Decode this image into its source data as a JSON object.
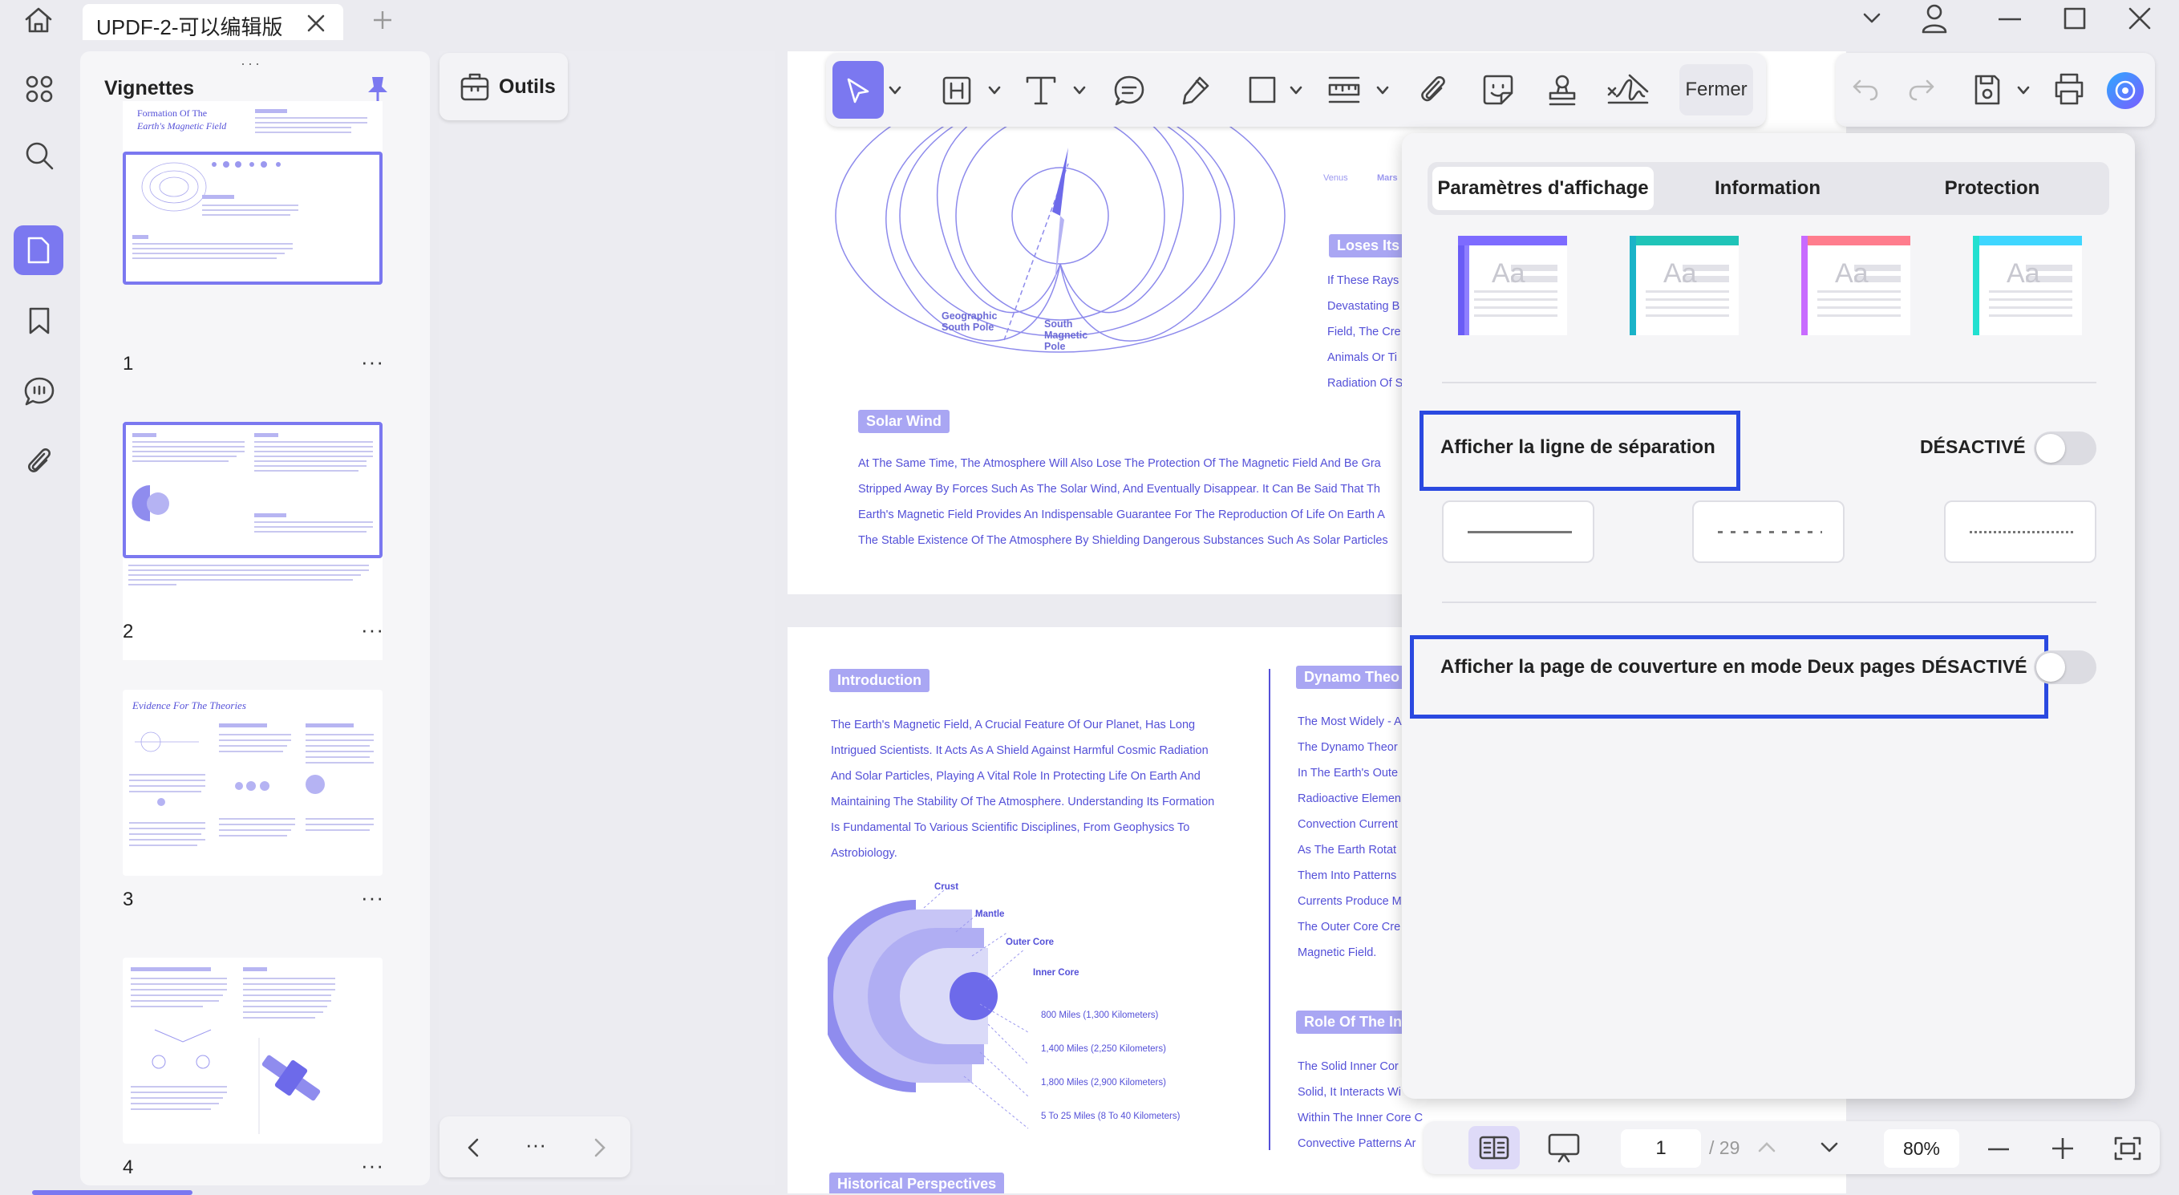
{
  "window": {
    "tab_title": "UPDF-2-可以编辑版"
  },
  "thumbnails": {
    "title": "Vignettes",
    "pages": [
      {
        "num": "1"
      },
      {
        "num": "2"
      },
      {
        "num": "3"
      },
      {
        "num": "4"
      }
    ],
    "more": "···",
    "thumb1_title": "Formation Of The",
    "thumb1_subtitle": "Earth's Magnetic Field",
    "thumb3_title": "Evidence For The Theories"
  },
  "middle": {
    "outils_label": "Outils",
    "nav_more": "···"
  },
  "toolbar": {
    "fermer_label": "Fermer"
  },
  "pdf": {
    "page_a": {
      "geo_label": "Geographic\nSouth Pole",
      "south_label": "South\nMagnetic\nPole",
      "venus": "Venus",
      "mars": "Mars",
      "loses": "Loses Its",
      "right_lines": [
        "If These Rays",
        "Devastating B",
        "Field, The Cre",
        "Animals Or Ti",
        "Radiation Of S"
      ],
      "solar_wind": "Solar Wind",
      "solar_lines": [
        "At The Same Time, The Atmosphere Will Also Lose The Protection Of The Magnetic Field And Be Gra",
        "Stripped Away By Forces Such As The Solar Wind, And Eventually Disappear. It Can Be Said That Th",
        "Earth's Magnetic Field Provides An Indispensable Guarantee For The Reproduction Of Life On Earth A",
        "The Stable Existence Of The Atmosphere By Shielding Dangerous Substances Such As Solar Particles"
      ]
    },
    "page_b": {
      "introduction": "Introduction",
      "intro_lines": [
        "The Earth's Magnetic Field, A Crucial Feature Of Our Planet, Has Long",
        "Intrigued Scientists. It Acts As A Shield Against Harmful Cosmic Radiation",
        "And Solar Particles, Playing A Vital Role In Protecting Life On Earth And",
        "Maintaining The Stability Of The Atmosphere. Understanding Its Formation",
        "Is Fundamental To Various Scientific Disciplines, From Geophysics To",
        "Astrobiology."
      ],
      "crust": "Crust",
      "mantle": "Mantle",
      "outer_core": "Outer Core",
      "inner_core": "Inner Core",
      "depths": [
        "800 Miles (1,300 Kilometers)",
        "1,400 Miles (2,250 Kilometers)",
        "1,800 Miles (2,900 Kilometers)",
        "5 To 25 Miles (8 To 40 Kilometers)"
      ],
      "dynamo": "Dynamo Theo",
      "dynamo_lines": [
        "The Most Widely - A",
        "The Dynamo Theor",
        "In The Earth's Oute",
        "Radioactive Elemen",
        "Convection Current",
        "As The Earth Rotat",
        "Them Into Patterns",
        "Currents Produce M",
        "The Outer Core Cre",
        "Magnetic Field."
      ],
      "role": "Role Of The In",
      "role_lines": [
        "The Solid Inner Cor",
        "Solid, It Interacts Wi",
        "Within The Inner Core C",
        "Convective Patterns Ar"
      ],
      "historical": "Historical Perspectives"
    }
  },
  "popup": {
    "tabs": [
      "Paramètres d'affichage",
      "Information",
      "Protection"
    ],
    "separator_label": "Afficher la ligne de séparation",
    "separator_state": "DÉSACTIVÉ",
    "cover_label": "Afficher la page de couverture en mode Deux pages",
    "cover_state": "DÉSACTIVÉ",
    "theme_text": "Aa"
  },
  "bottombar": {
    "page_current": "1",
    "page_total": "/ 29",
    "zoom": "80%"
  },
  "colors": {
    "accent": "#7b78f0",
    "highlight": "#2a49e0",
    "pdf_text": "#5450d8"
  }
}
